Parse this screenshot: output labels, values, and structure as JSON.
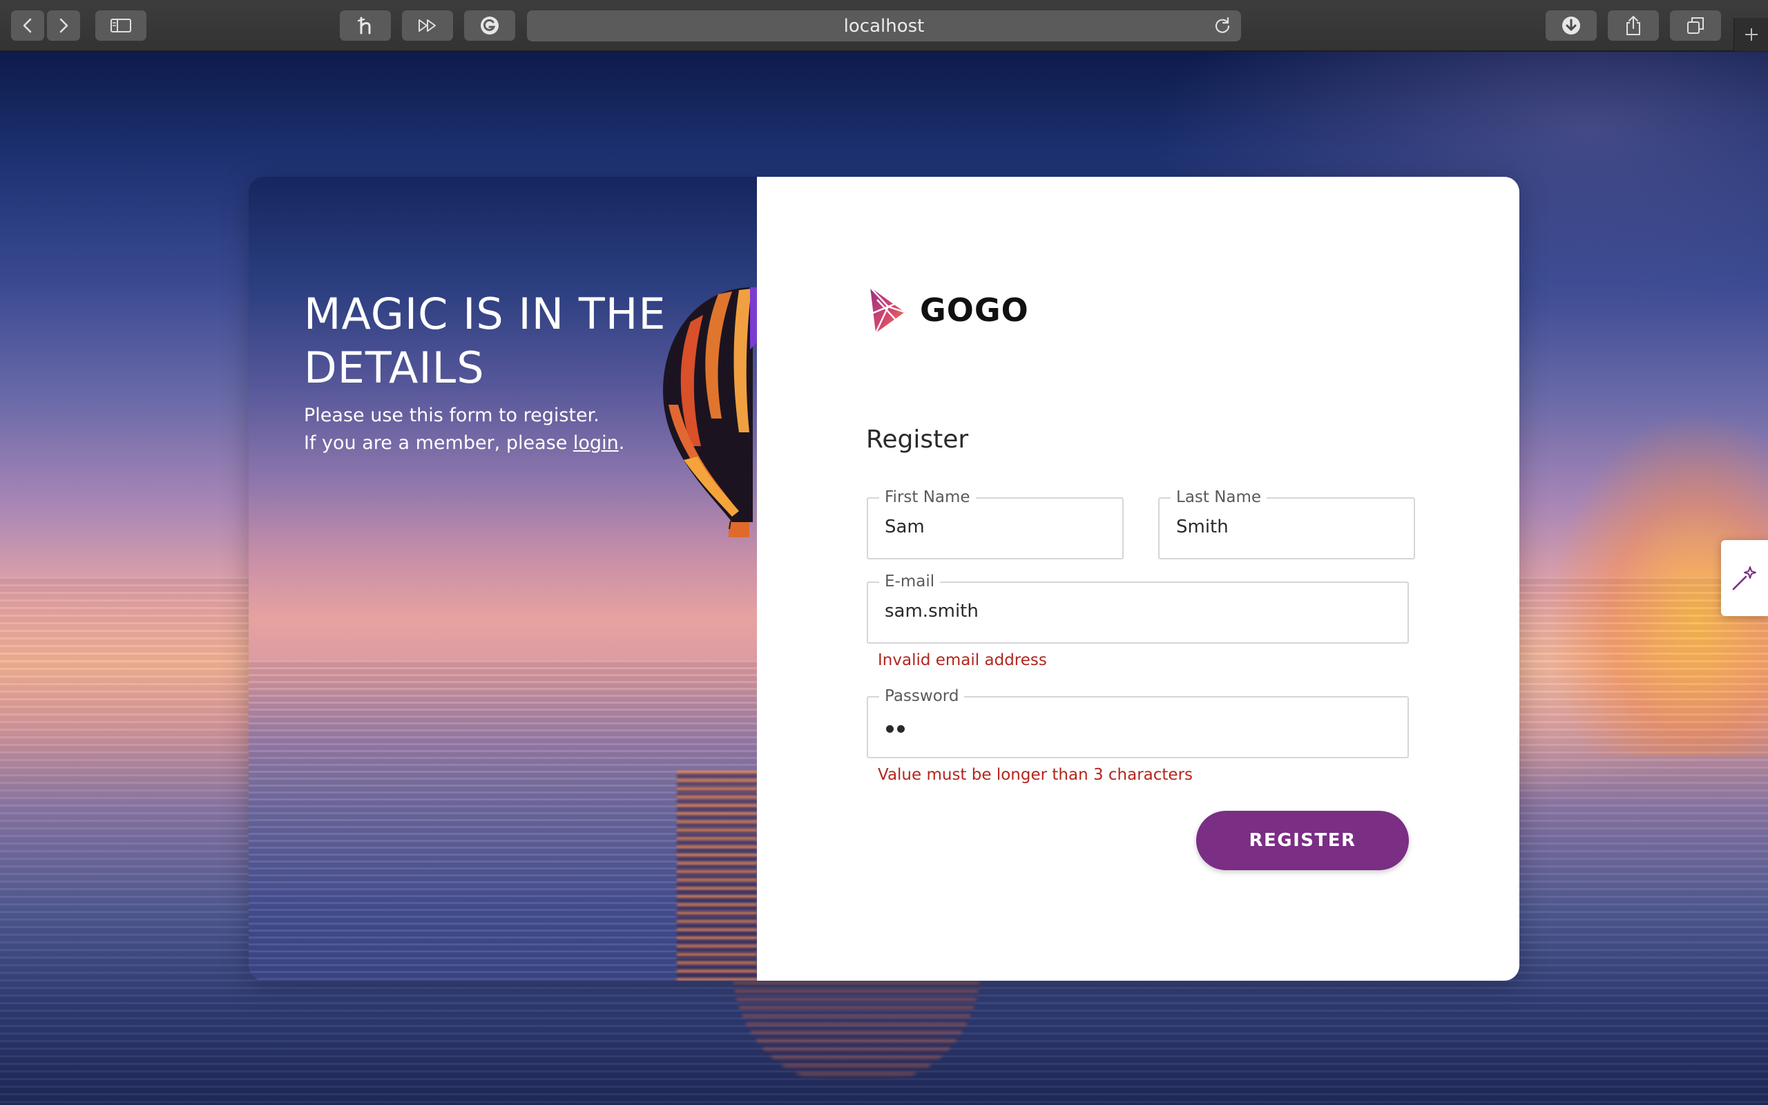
{
  "browser": {
    "url": "localhost"
  },
  "hero": {
    "title": "MAGIC IS IN THE DETAILS",
    "text_line1": "Please use this form to register.",
    "text_line2_prefix": "If you are a member, please ",
    "login_link": "login",
    "text_line2_suffix": "."
  },
  "brand": {
    "name": "GOGO",
    "accent_color": "#7a2e84"
  },
  "form": {
    "title": "Register",
    "first_name": {
      "label": "First Name",
      "value": "Sam"
    },
    "last_name": {
      "label": "Last Name",
      "value": "Smith"
    },
    "email": {
      "label": "E-mail",
      "value": "sam.smith",
      "error": "Invalid email address"
    },
    "password": {
      "label": "Password",
      "value": "••",
      "error": "Value must be longer than 3 characters"
    },
    "submit_label": "REGISTER",
    "error_color": "#b3261e"
  },
  "icons": {
    "toolbar": [
      "back-icon",
      "forward-icon",
      "sidebar-icon",
      "honey-icon",
      "fast-forward-icon",
      "grammarly-icon",
      "reload-icon",
      "download-icon",
      "share-icon",
      "tabs-icon",
      "new-tab-icon"
    ],
    "side_widget": "magic-wand-icon"
  }
}
